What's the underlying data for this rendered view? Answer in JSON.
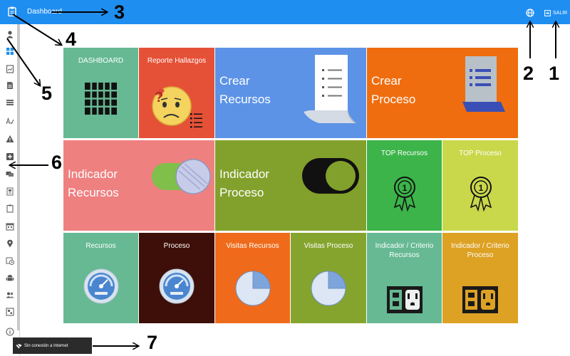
{
  "topbar": {
    "title": "Dashboard",
    "logout_label": "SALIR"
  },
  "tiles": {
    "dashboard": "DASHBOARD",
    "reporte": "Reporte Hallazgos",
    "crear_recursos": [
      "Crear",
      "Recursos"
    ],
    "crear_proceso": [
      "Crear",
      "Proceso"
    ],
    "indicador_recursos": [
      "Indicador",
      "Recursos"
    ],
    "indicador_proceso": [
      "Indicador",
      "Proceso"
    ],
    "top_recursos": "TOP Recursos",
    "top_proceso": "TOP Proceso",
    "recursos": "Recursos",
    "proceso": "Proceso",
    "visitas_recursos": "Visitas Recursos",
    "visitas_proceso": "Visitas Proceso",
    "criterio_recursos": "Indicador / Criterio Recursos",
    "criterio_proceso": "Indicador / Criterio Proceso"
  },
  "medal_number": "1",
  "toast": {
    "text": "Sin conexión a Internet"
  },
  "annotations": [
    "1",
    "2",
    "3",
    "4",
    "5",
    "6",
    "7"
  ],
  "colors": {
    "topbar": "#1f8ef1",
    "green": "#66b993",
    "red": "#e55137",
    "blue": "#5c93e6",
    "orange": "#ef6d0f",
    "pink": "#ef8080",
    "olive": "#82a12c",
    "bright_green": "#3cb44a",
    "lime": "#c9d84b",
    "dark_brown": "#3d0f08",
    "orange_alt": "#ef6b1b",
    "olive_alt": "#85a42e",
    "mustard": "#dda123"
  }
}
